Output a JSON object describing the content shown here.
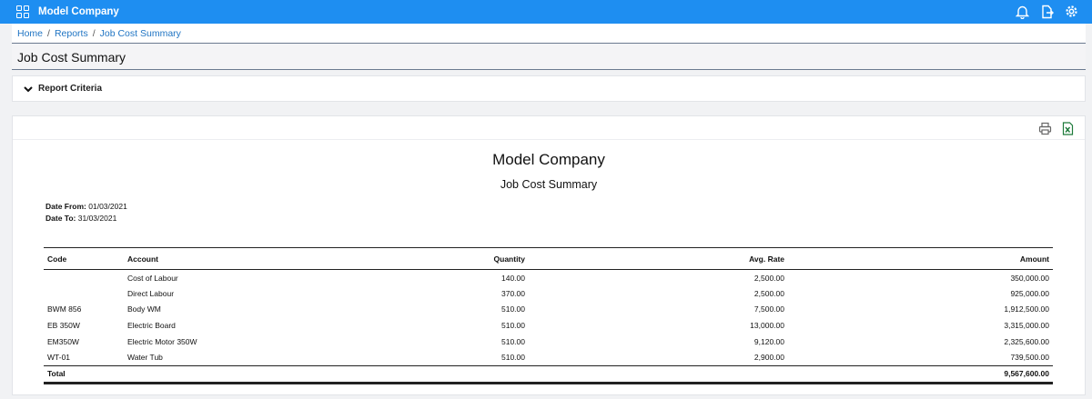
{
  "header": {
    "company": "Model Company"
  },
  "breadcrumb": [
    "Home",
    "Reports",
    "Job Cost Summary"
  ],
  "page_title": "Job Cost Summary",
  "criteria_label": "Report Criteria",
  "icons": [
    "apps-grid-icon",
    "bell-icon",
    "export-icon",
    "gear-icon",
    "chevron-down-icon",
    "print-icon",
    "excel-icon"
  ],
  "report": {
    "company": "Model Company",
    "title": "Job Cost Summary",
    "date_from_label": "Date From:",
    "date_from": "01/03/2021",
    "date_to_label": "Date To:",
    "date_to": "31/03/2021",
    "columns": {
      "code": "Code",
      "account": "Account",
      "quantity": "Quantity",
      "rate": "Avg. Rate",
      "amount": "Amount"
    },
    "rows": [
      {
        "code": "",
        "account": "Cost of Labour",
        "quantity": "140.00",
        "rate": "2,500.00",
        "amount": "350,000.00"
      },
      {
        "code": "",
        "account": "Direct Labour",
        "quantity": "370.00",
        "rate": "2,500.00",
        "amount": "925,000.00"
      },
      {
        "code": "BWM 856",
        "account": "Body WM",
        "quantity": "510.00",
        "rate": "7,500.00",
        "amount": "1,912,500.00"
      },
      {
        "code": "EB 350W",
        "account": "Electric Board",
        "quantity": "510.00",
        "rate": "13,000.00",
        "amount": "3,315,000.00"
      },
      {
        "code": "EM350W",
        "account": "Electric Motor 350W",
        "quantity": "510.00",
        "rate": "9,120.00",
        "amount": "2,325,600.00"
      },
      {
        "code": "WT-01",
        "account": "Water Tub",
        "quantity": "510.00",
        "rate": "2,900.00",
        "amount": "739,500.00"
      }
    ],
    "total_label": "Total",
    "total_amount": "9,567,600.00"
  }
}
